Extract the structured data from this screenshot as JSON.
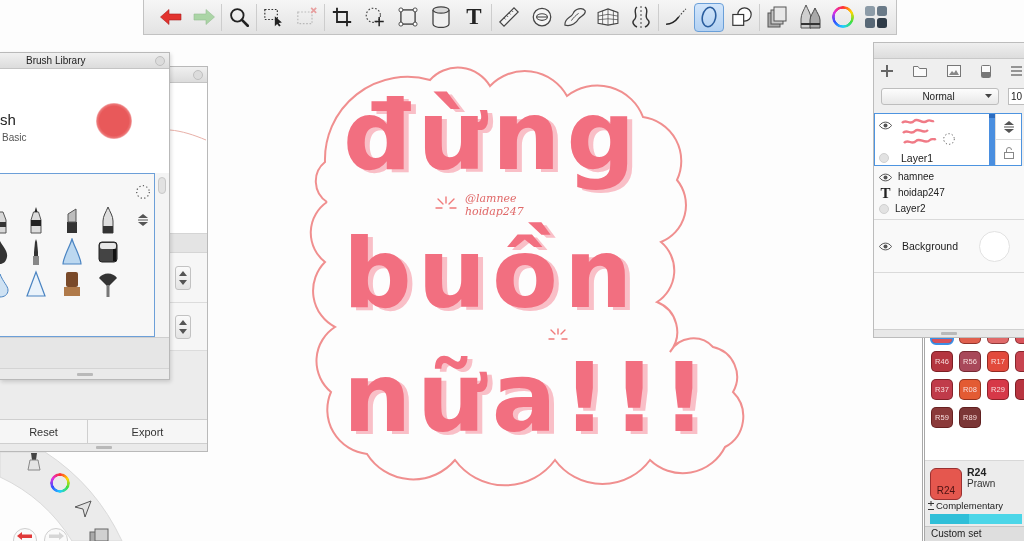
{
  "toolbar": {
    "groups": [
      [
        {
          "kind": "undo",
          "selected": false,
          "disabled": false
        },
        {
          "kind": "redo",
          "selected": false,
          "disabled": true
        }
      ],
      [
        {
          "kind": "zoom",
          "selected": false,
          "disabled": false
        }
      ],
      [
        {
          "kind": "select",
          "selected": false,
          "disabled": false
        },
        {
          "kind": "deselect",
          "selected": false,
          "disabled": true
        }
      ],
      [
        {
          "kind": "crop",
          "selected": false,
          "disabled": false
        },
        {
          "kind": "transform",
          "selected": false,
          "disabled": false
        },
        {
          "kind": "distort",
          "selected": false,
          "disabled": false
        },
        {
          "kind": "fill",
          "selected": false,
          "disabled": false
        },
        {
          "kind": "text",
          "glyph": "T",
          "selected": false,
          "disabled": false
        }
      ],
      [
        {
          "kind": "ruler",
          "selected": false,
          "disabled": false
        },
        {
          "kind": "ellipse",
          "selected": false,
          "disabled": false
        },
        {
          "kind": "curve",
          "selected": false,
          "disabled": false
        },
        {
          "kind": "perspective",
          "selected": false,
          "disabled": false
        },
        {
          "kind": "symmetry",
          "selected": false,
          "disabled": false
        }
      ],
      [
        {
          "kind": "stroke",
          "selected": false,
          "disabled": false
        },
        {
          "kind": "oval",
          "selected": true,
          "disabled": false
        },
        {
          "kind": "shapes",
          "selected": false,
          "disabled": false
        }
      ],
      [
        {
          "kind": "layers",
          "selected": false,
          "disabled": false
        },
        {
          "kind": "brushes",
          "selected": false,
          "disabled": false
        },
        {
          "kind": "colors",
          "selected": false,
          "disabled": false
        },
        {
          "kind": "copic",
          "selected": false,
          "disabled": false
        }
      ]
    ]
  },
  "brush_library": {
    "title": "Brush Library",
    "brush_name": "sh",
    "brush_set": "Basic"
  },
  "brush_settings": {
    "buttons": [
      "Reset",
      "Export"
    ]
  },
  "canvas": {
    "lettering": [
      "đừng",
      "buồn",
      "nữa!!!"
    ],
    "signature": [
      "@lamnee",
      "hoidap247"
    ]
  },
  "layers": {
    "blend_mode": "Normal",
    "opacity": "10",
    "items": [
      {
        "kind": "layer",
        "name": "Layer1",
        "selected": true
      },
      {
        "kind": "group",
        "selected": false,
        "rows": [
          {
            "kind": "eye",
            "name": "hamnee"
          },
          {
            "kind": "text",
            "glyph": "T",
            "name": "hoidap247"
          },
          {
            "kind": "dot",
            "name": "Layer2"
          }
        ]
      },
      {
        "kind": "background",
        "name": "Background",
        "selected": false
      }
    ]
  },
  "colors": {
    "swatch_rows": [
      [
        {
          "color": "#d8505a",
          "selected": true
        },
        {
          "color": "#e0604e",
          "selected": false
        },
        {
          "color": "#e06a6a",
          "selected": false
        },
        {
          "color": "#d9535a",
          "selected": false
        }
      ],
      [
        {
          "label": "R46",
          "color": "#b4353f",
          "selected": false
        },
        {
          "label": "R56",
          "color": "#a8485a",
          "selected": false
        },
        {
          "label": "R17",
          "color": "#e24a3c",
          "selected": false
        },
        {
          "color": "#c84450",
          "selected": false
        }
      ],
      [
        {
          "label": "R37",
          "color": "#c03b4a",
          "selected": false
        },
        {
          "label": "R08",
          "color": "#e35b33",
          "selected": false
        },
        {
          "label": "R29",
          "color": "#d63848",
          "selected": false
        },
        {
          "color": "#b83440",
          "selected": false
        }
      ],
      [
        {
          "label": "R59",
          "color": "#8b3a3a",
          "selected": false
        },
        {
          "label": "R89",
          "color": "#7b3636",
          "selected": false
        }
      ]
    ],
    "current": {
      "swatch_label": "R24",
      "code": "R24",
      "name": "Prawn"
    },
    "complementary": "Complementary",
    "set_name": "Custom set"
  }
}
